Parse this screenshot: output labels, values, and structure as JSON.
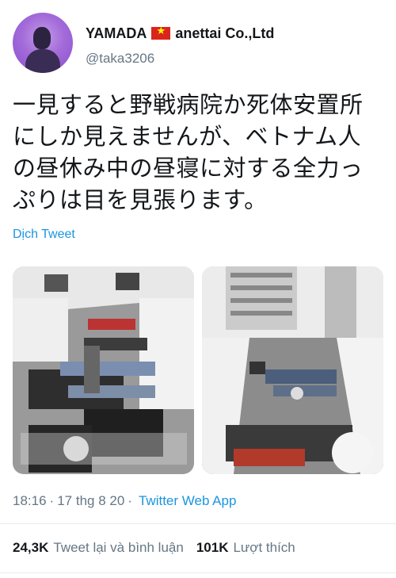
{
  "user": {
    "name": "YAMADA",
    "flag_icon": "vietnam-flag-icon",
    "company": "anettai Co.,Ltd",
    "handle": "@taka3206"
  },
  "tweet": {
    "lines": [
      "一見すると野戦病院か死体安置所",
      "にしか見えませんが、ベトナム人",
      "の昼休み中の昼寝に対する全力っ",
      "ぷりは目を見張ります。"
    ],
    "translate_label": "Dịch Tweet"
  },
  "meta": {
    "time": "18:16",
    "date": "17 thg 8 20",
    "separator": "·",
    "app": "Twitter Web App"
  },
  "stats": {
    "retweets_count": "24,3K",
    "retweets_label": "Tweet lại và bình luận",
    "likes_count": "101K",
    "likes_label": "Lượt thích"
  },
  "colors": {
    "link": "#1b95e0",
    "muted": "#657786",
    "text": "#14171a",
    "flag_red": "#da251d",
    "flag_star": "#ffff00"
  }
}
